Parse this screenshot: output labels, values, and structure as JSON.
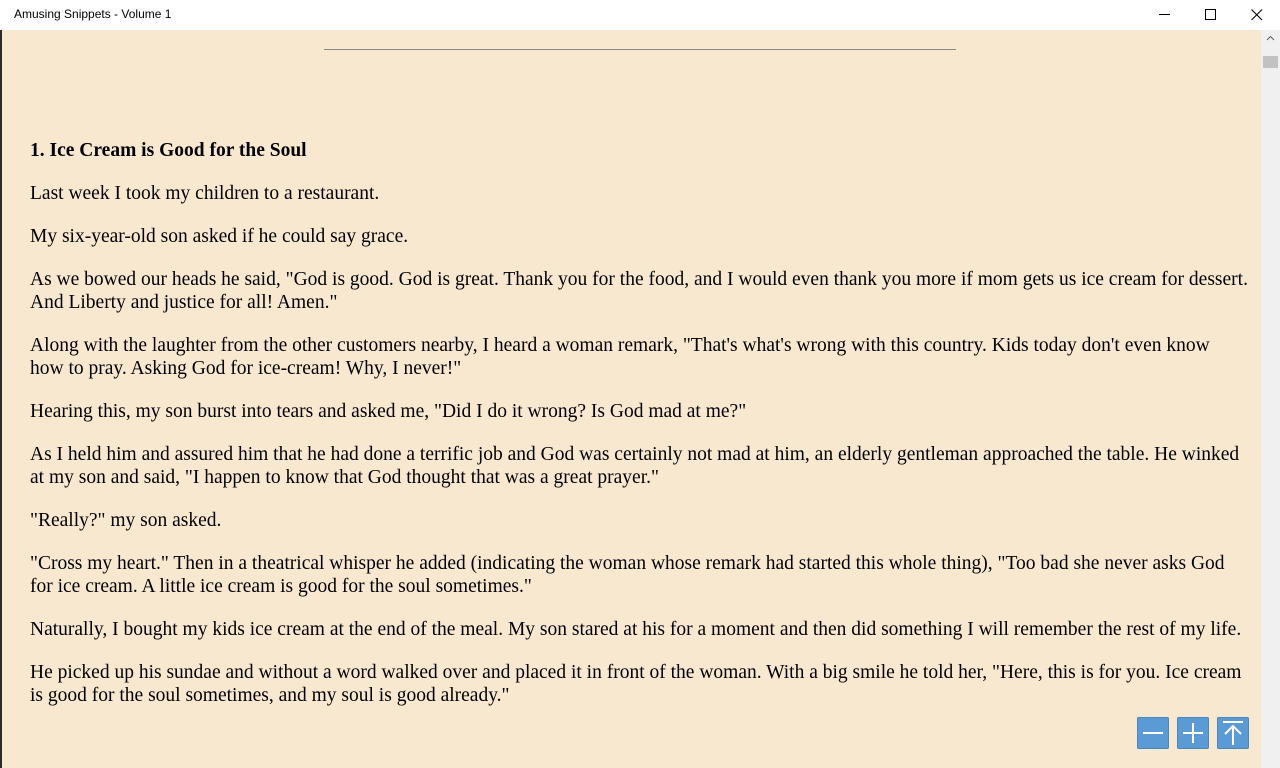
{
  "window": {
    "title": "Amusing Snippets - Volume 1"
  },
  "article": {
    "heading": "1. Ice Cream is Good for the Soul",
    "paragraphs": [
      "Last week I took my children to a restaurant.",
      "My six-year-old son asked if he could say grace.",
      "As we bowed our heads he said, \"God is good. God is great. Thank you for the food, and I would even thank you more if mom gets us ice cream for dessert. And Liberty and justice for all! Amen.\"",
      "Along with the laughter from the other customers nearby, I heard a woman remark, \"That's what's wrong with this country. Kids today don't even know how to pray. Asking God for ice-cream! Why, I never!\"",
      "Hearing this, my son burst into tears and asked me, \"Did I do it wrong? Is God mad at me?\"",
      "As I held him and assured him that he had done a terrific job and God was certainly not mad at him, an elderly gentleman approached the table. He winked at my son and said, \"I happen to know that God thought that was a great prayer.\"",
      "\"Really?\" my son asked.",
      "\"Cross my heart.\" Then in a theatrical whisper he added (indicating the woman whose remark had started this whole thing), \"Too bad she never asks God for ice cream. A little ice cream is good for the soul sometimes.\"",
      "Naturally, I bought my kids ice cream at the end of the meal. My son stared at his for a moment and then did something I will remember the rest of my life.",
      "He picked up his sundae and without a word walked over and placed it in front of the woman. With a big smile he told her, \"Here, this is for you. Ice cream is good for the soul sometimes, and my soul is good already.\""
    ]
  },
  "controls": {
    "decrease_font_icon": "minus-icon",
    "increase_font_icon": "plus-icon",
    "scroll_top_icon": "arrow-to-top-icon",
    "accent_color": "#5b9bd5",
    "background_color": "#f9e8d0"
  }
}
